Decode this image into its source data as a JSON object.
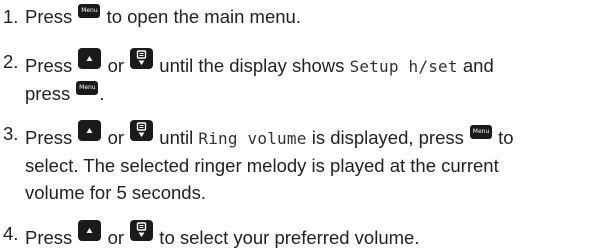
{
  "steps": [
    {
      "number": "1.",
      "parts": {
        "a": "Press ",
        "b": " to open the main menu."
      }
    },
    {
      "number": "2.",
      "parts": {
        "a": "Press ",
        "b": " or ",
        "c": " until the display shows ",
        "display": "Setup h/set",
        "d": " and",
        "e": "press ",
        "f": "."
      }
    },
    {
      "number": "3.",
      "parts": {
        "a": "Press ",
        "b": " or ",
        "c": " until ",
        "display": "Ring volume",
        "d": " is displayed, press ",
        "e": " to",
        "f": "select. The selected ringer melody is played at the current",
        "g": "volume for 5 seconds."
      }
    },
    {
      "number": "4.",
      "parts": {
        "a": "Press ",
        "b": " or ",
        "c": " to select your preferred volume."
      }
    }
  ],
  "keys": {
    "menu_label": "Menu",
    "up_icon": "up-arrow-key-icon",
    "down_icon": "phonebook-down-key-icon"
  }
}
